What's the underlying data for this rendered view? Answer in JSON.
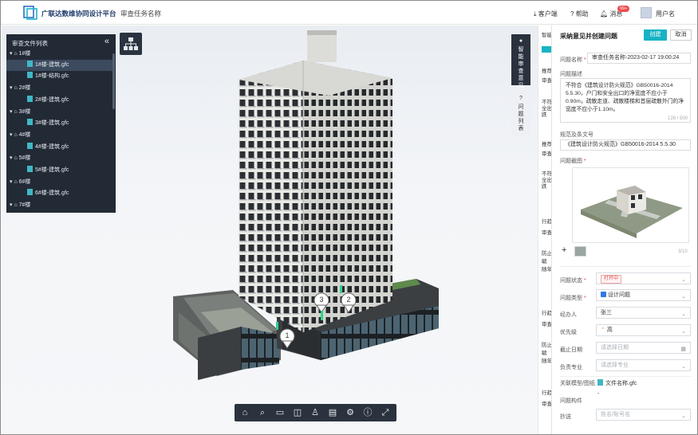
{
  "topbar": {
    "brand": "广联达数维协同设计平台",
    "task_name": "审查任务名称",
    "client_label": "客户端",
    "help_label": "帮助",
    "message_label": "消息",
    "message_badge": "99+",
    "user_name": "用户名"
  },
  "tree": {
    "header": "审查文件列表",
    "items": [
      {
        "label": "1#楼",
        "level": 0
      },
      {
        "label": "1#楼-建筑.gfc",
        "level": 1,
        "selected": true
      },
      {
        "label": "1#楼-结构.gfc",
        "level": 1
      },
      {
        "label": "2#楼",
        "level": 0
      },
      {
        "label": "2#楼-建筑.gfc",
        "level": 1
      },
      {
        "label": "3#楼",
        "level": 0
      },
      {
        "label": "3#楼-建筑.gfc",
        "level": 1
      },
      {
        "label": "4#楼",
        "level": 0
      },
      {
        "label": "4#楼-建筑.gfc",
        "level": 1
      },
      {
        "label": "5#楼",
        "level": 0
      },
      {
        "label": "5#楼-建筑.gfc",
        "level": 1
      },
      {
        "label": "6#楼",
        "level": 0
      },
      {
        "label": "6#楼-建筑.gfc",
        "level": 1
      },
      {
        "label": "7#楼",
        "level": 0
      }
    ]
  },
  "markers": [
    "1",
    "2",
    "3"
  ],
  "side_tabs": {
    "smart": "智能审查意见",
    "issues": "问题列表"
  },
  "behind_panel": {
    "header": "智能",
    "status_sample": "推荐",
    "label_a": "审查",
    "text_a": "不符",
    "text_b": "全出",
    "text_c": "跌",
    "label_b": "行趋",
    "text_d": "防止",
    "text_e": "毓",
    "text_f": "随年"
  },
  "panel": {
    "title": "采纳意见并创建问题",
    "create_label": "创建",
    "cancel_label": "取消",
    "name_label": "问题名称",
    "name_value": "审查任务名称-2023-02-17  19:00:24",
    "desc_label": "问题描述",
    "desc_value": "不符合《建筑设计防火规范》GB50016-2014 5.5.30，户门和安全出口的净宽度不应小于 0.90m，疏散走道、疏散楼梯和首层疏散外门的净宽度不应小于1.10m。",
    "desc_counter": "126 / 500",
    "spec_label": "规范及条文号",
    "spec_value": "《建筑设计防火规范》GB50016-2014 5.5.30",
    "shot_label": "问题截图",
    "shot_counter": "3/10",
    "status_label": "问题状态",
    "status_value": "打开中",
    "type_label": "问题类型",
    "type_value": "设计问题",
    "handler_label": "经办人",
    "handler_value": "张三",
    "priority_label": "优先级",
    "priority_value": "高",
    "deadline_label": "截止日期",
    "deadline_placeholder": "请选择日期",
    "discipline_label": "负责专业",
    "discipline_placeholder": "请选择专业",
    "model_label": "关联模型/图纸",
    "model_value": "文件名称.gfc",
    "component_label": "问题构件",
    "component_value": "-",
    "cc_label": "抄送",
    "cc_placeholder": "姓名/账号名"
  },
  "colors": {
    "accent": "#17b3c4",
    "tree_bg": "#222a36",
    "danger": "#e04848",
    "priority": "#f07c2a"
  }
}
